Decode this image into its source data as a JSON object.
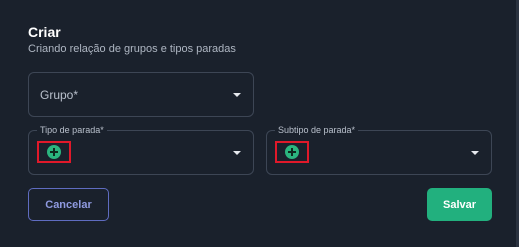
{
  "dialog": {
    "title": "Criar",
    "subtitle": "Criando relação de grupos e tipos paradas"
  },
  "fields": {
    "grupo": {
      "placeholder": "Grupo*"
    },
    "tipo": {
      "label": "Tipo de parada*",
      "add_icon": "plus-circle-icon"
    },
    "subtipo": {
      "label": "Subtipo de parada*",
      "add_icon": "plus-circle-icon"
    }
  },
  "actions": {
    "cancel_label": "Cancelar",
    "save_label": "Salvar"
  },
  "colors": {
    "background": "#1a212c",
    "primary": "#22b07e",
    "secondary": "#5f6cc0",
    "highlight": "#e0192a"
  }
}
